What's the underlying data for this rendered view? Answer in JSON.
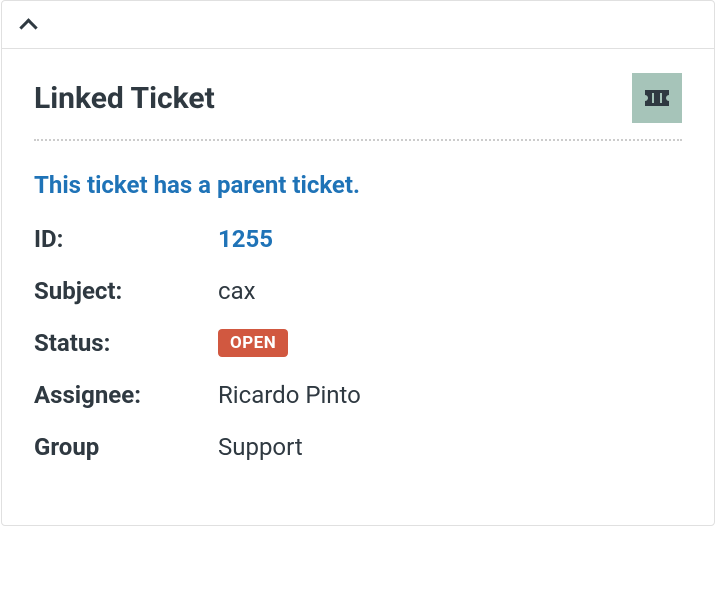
{
  "panel": {
    "section_title": "Linked Ticket",
    "parent_notice": "This ticket has a parent ticket.",
    "fields": {
      "id": {
        "label": "ID:",
        "value": "1255"
      },
      "subject": {
        "label": "Subject:",
        "value": "cax"
      },
      "status": {
        "label": "Status:",
        "value": "OPEN"
      },
      "assignee": {
        "label": "Assignee:",
        "value": "Ricardo Pinto"
      },
      "group": {
        "label": "Group",
        "value": "Support"
      }
    }
  }
}
